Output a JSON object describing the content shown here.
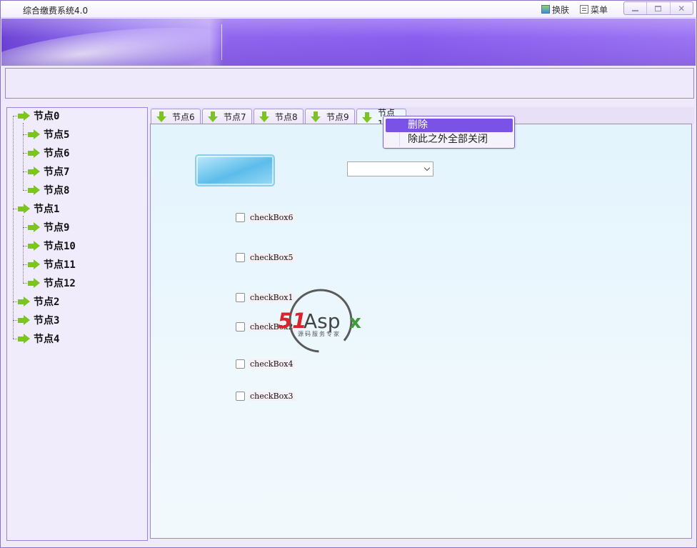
{
  "window": {
    "title": "综合缴费系统4.0",
    "skin_label": "换肤",
    "menu_label": "菜单"
  },
  "tree": {
    "items": [
      {
        "label": "节点0",
        "level": 0
      },
      {
        "label": "节点5",
        "level": 1
      },
      {
        "label": "节点6",
        "level": 1
      },
      {
        "label": "节点7",
        "level": 1
      },
      {
        "label": "节点8",
        "level": 1
      },
      {
        "label": "节点1",
        "level": 0
      },
      {
        "label": "节点9",
        "level": 1
      },
      {
        "label": "节点10",
        "level": 1
      },
      {
        "label": "节点11",
        "level": 1
      },
      {
        "label": "节点12",
        "level": 1
      },
      {
        "label": "节点2",
        "level": 0
      },
      {
        "label": "节点3",
        "level": 0
      },
      {
        "label": "节点4",
        "level": 0
      }
    ]
  },
  "tabs": [
    {
      "label": "节点6"
    },
    {
      "label": "节点7"
    },
    {
      "label": "节点8"
    },
    {
      "label": "节点9"
    },
    {
      "label": "节点10",
      "active": true
    }
  ],
  "checkboxes": [
    {
      "label": "checkBox6",
      "checked": false
    },
    {
      "label": "checkBox5",
      "checked": false
    },
    {
      "label": "checkBox1",
      "checked": false
    },
    {
      "label": "checkBox2",
      "checked": false
    },
    {
      "label": "checkBox4",
      "checked": false
    },
    {
      "label": "checkBox3",
      "checked": false
    }
  ],
  "dropdown": {
    "value": ""
  },
  "context_menu": {
    "items": [
      {
        "label": "删除",
        "highlighted": true
      },
      {
        "label": "除此之外全部关闭",
        "highlighted": false
      }
    ]
  },
  "watermark": {
    "brand": "51Aspx",
    "tagline": "源码服务专家"
  },
  "colors": {
    "accent": "#7a52e6",
    "arrow_green": "#7cc51c",
    "border": "#9a86d4",
    "brand_red": "#d9232d",
    "brand_green": "#3f9a3c"
  }
}
